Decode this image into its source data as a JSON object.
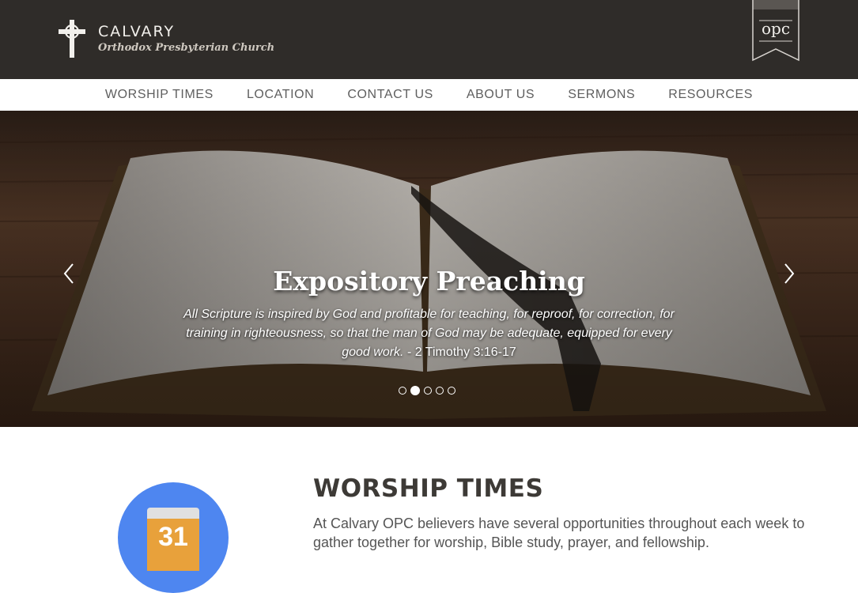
{
  "header": {
    "brand_name": "CALVARY",
    "brand_subtitle": "Orthodox Presbyterian Church",
    "logo_icon": "celtic-cross-icon",
    "badge_text": "opc",
    "colors": {
      "header_bg": "#2f2c29",
      "badge": "#d8d4cf"
    }
  },
  "nav": {
    "items": [
      {
        "label": "WORSHIP TIMES"
      },
      {
        "label": "LOCATION"
      },
      {
        "label": "CONTACT US"
      },
      {
        "label": "ABOUT US"
      },
      {
        "label": "SERMONS"
      },
      {
        "label": "RESOURCES"
      }
    ]
  },
  "hero": {
    "title": "Expository Preaching",
    "quote": "All Scripture is inspired by God and profitable for teaching, for reproof, for correction, for training in righteousness, so that the man of God may be adequate, equipped for every good work.",
    "reference": "- 2 Timothy 3:16-17",
    "prev_icon": "chevron-left-icon",
    "next_icon": "chevron-right-icon",
    "slide_count": 5,
    "active_slide": 2
  },
  "worship": {
    "icon": "calendar-icon",
    "calendar_day": "31",
    "title": "WORSHIP TIMES",
    "text": "At Calvary OPC believers have several opportunities throughout each week to gather together for worship, Bible study, prayer, and fellowship.",
    "colors": {
      "circle": "#4e86f0",
      "calendar": "#e8a13b"
    }
  }
}
